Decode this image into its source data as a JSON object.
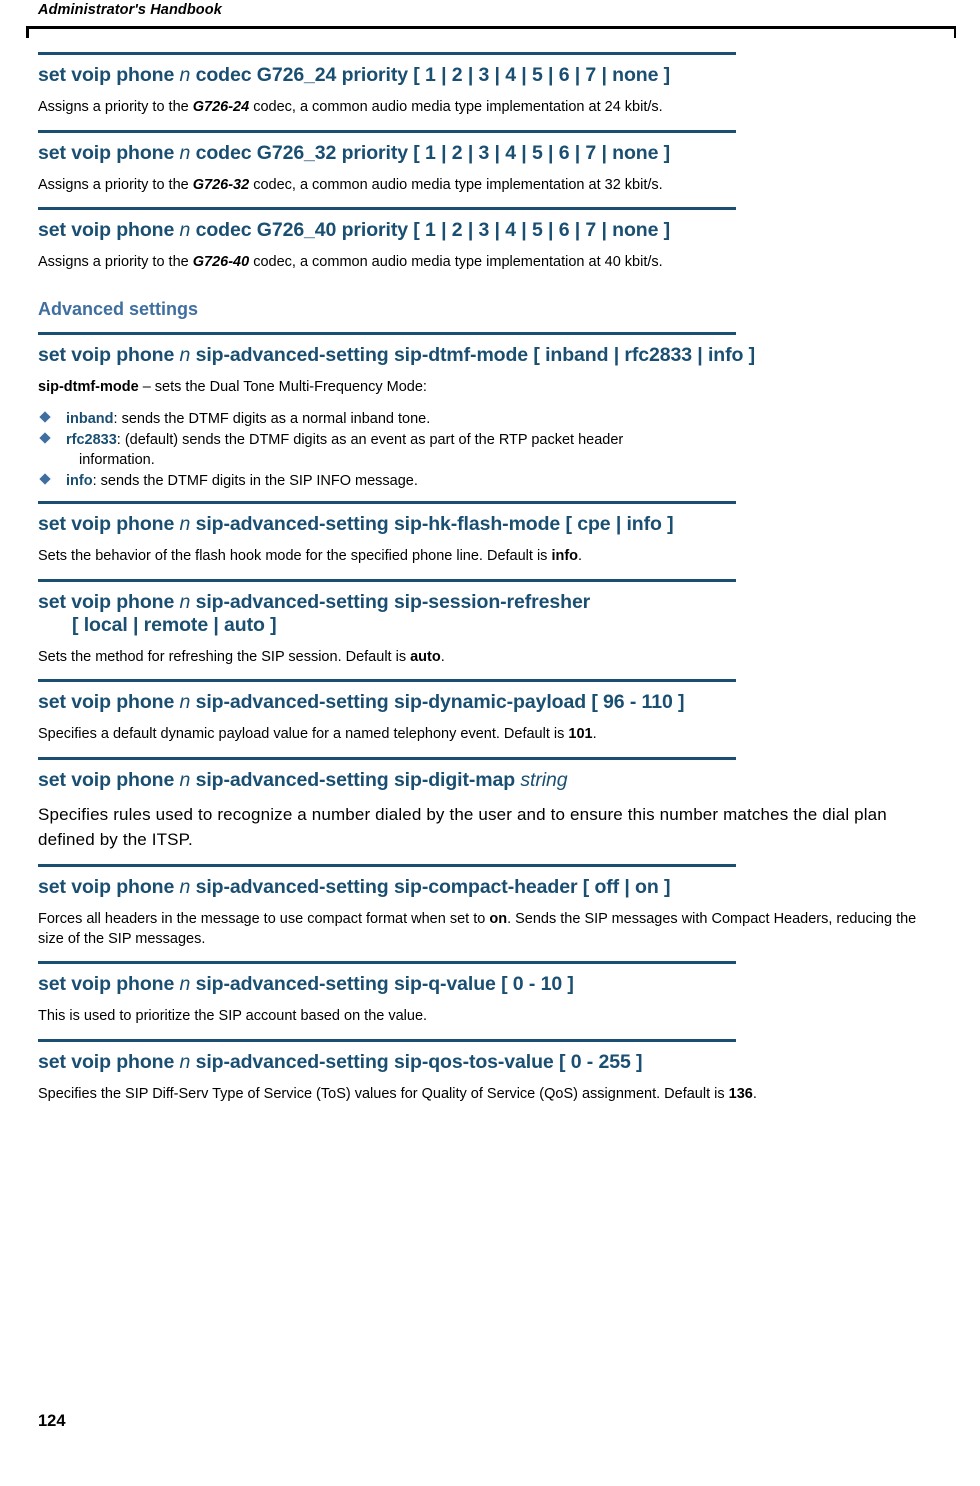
{
  "header": {
    "title": "Administrator's Handbook"
  },
  "footer": {
    "page_number": "124"
  },
  "sections": [
    {
      "cmd_prefix": "set voip phone ",
      "cmd_var": "n",
      "cmd_suffix": " codec G726_24 priority [ 1 | 2 | 3 | 4 | 5 | 6 | 7 | none ]",
      "desc_pre": "Assigns a priority to the ",
      "desc_em": "G726-24",
      "desc_post": " codec, a common audio media type implementation at 24 kbit/s."
    },
    {
      "cmd_prefix": "set voip phone ",
      "cmd_var": "n",
      "cmd_suffix": " codec G726_32 priority [ 1 | 2 | 3 | 4 | 5 | 6 | 7 | none ]",
      "desc_pre": "Assigns a priority to the ",
      "desc_em": "G726-32",
      "desc_post": " codec, a common audio media type implementation at 32 kbit/s."
    },
    {
      "cmd_prefix": "set voip phone ",
      "cmd_var": "n",
      "cmd_suffix": " codec G726_40 priority [ 1 | 2 | 3 | 4 | 5 | 6 | 7 | none ]",
      "desc_pre": "Assigns a priority to the ",
      "desc_em": "G726-40",
      "desc_post": " codec, a common audio media type implementation at 40 kbit/s."
    }
  ],
  "advanced": {
    "heading": "Advanced settings",
    "dtmf": {
      "cmd_prefix": "set voip phone ",
      "cmd_var": "n",
      "cmd_suffix": " sip-advanced-setting sip-dtmf-mode [ inband | rfc2833 | info ]",
      "desc_bold": "sip-dtmf-mode",
      "desc_rest": " – sets the Dual Tone Multi-Frequency Mode:",
      "bullets": [
        {
          "term": "inband",
          "text": ": sends the DTMF digits as a normal inband tone.",
          "cont": ""
        },
        {
          "term": "rfc2833",
          "text": ": (default) sends the DTMF digits as an event as part of the RTP packet header",
          "cont": "information."
        },
        {
          "term": "info",
          "text": ": sends the DTMF digits in the SIP INFO message.",
          "cont": ""
        }
      ]
    },
    "hk_flash": {
      "cmd_prefix": "set voip phone ",
      "cmd_var": "n",
      "cmd_suffix": " sip-advanced-setting sip-hk-flash-mode [ cpe | info ]",
      "desc_pre": "Sets the behavior of the flash hook mode for the specified phone line. Default is ",
      "desc_bold": "info",
      "desc_post": "."
    },
    "session_refresher": {
      "cmd_prefix": "set voip phone ",
      "cmd_var": "n",
      "cmd_suffix": " sip-advanced-setting sip-session-refresher",
      "cmd_line2": "[ local | remote | auto ]",
      "desc_pre": "Sets the method for refreshing the SIP session. Default is ",
      "desc_bold": "auto",
      "desc_post": "."
    },
    "dynamic_payload": {
      "cmd_prefix": "set voip phone ",
      "cmd_var": "n",
      "cmd_suffix": " sip-advanced-setting sip-dynamic-payload [ 96 - 110 ]",
      "desc_pre": "Specifies a default dynamic payload value for a named telephony event. Default is ",
      "desc_bold": "101",
      "desc_post": "."
    },
    "digit_map": {
      "cmd_prefix": "set voip phone ",
      "cmd_var": "n",
      "cmd_suffix": " sip-advanced-setting sip-digit-map ",
      "cmd_var2": "string",
      "desc": "Specifies rules used to recognize a number dialed by the user and to ensure this number matches the dial plan defined by the ITSP."
    },
    "compact_header": {
      "cmd_prefix": "set voip phone ",
      "cmd_var": "n",
      "cmd_suffix": " sip-advanced-setting sip-compact-header [ off | on ]",
      "desc_pre": "Forces all headers in the message to use compact format when set to ",
      "desc_bold": "on",
      "desc_post": ". Sends the SIP messages with Compact Headers, reducing the size of the SIP messages."
    },
    "q_value": {
      "cmd_prefix": "set voip phone ",
      "cmd_var": "n",
      "cmd_suffix": " sip-advanced-setting sip-q-value [ 0 - 10 ]",
      "desc": "This is used to prioritize the SIP account based on the value."
    },
    "qos_tos": {
      "cmd_prefix": "set voip phone ",
      "cmd_var": "n",
      "cmd_suffix": " sip-advanced-setting sip-qos-tos-value [ 0 - 255 ]",
      "desc_pre": "Specifies the SIP Diff-Serv Type of Service (ToS) values for Quality of Service (QoS) assignment. Default is ",
      "desc_bold": "136",
      "desc_post": "."
    }
  }
}
